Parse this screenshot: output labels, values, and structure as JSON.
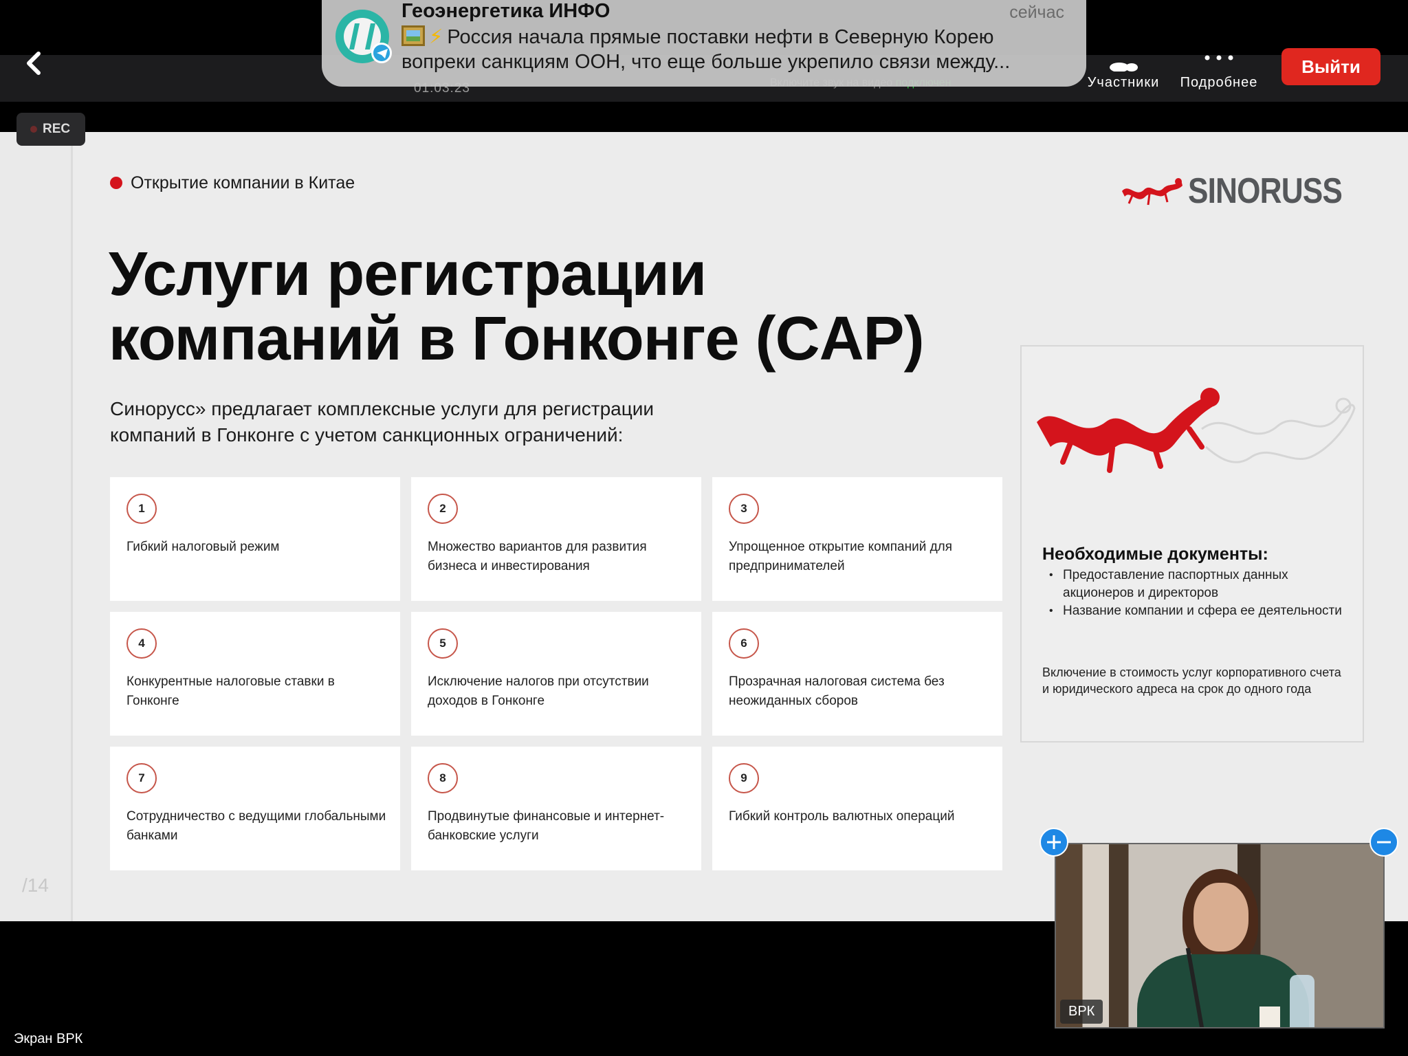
{
  "toolbar": {
    "timer": "01:03:23",
    "video_hint_prefix": "Включите звук на видео ",
    "video_hint_status": "подключен",
    "participants_label": "Участники",
    "more_label": "Подробнее",
    "leave_label": "Выйти",
    "rec_label": "REC"
  },
  "notification": {
    "title": "Геоэнергетика ИНФО",
    "time": "сейчас",
    "body": "Россия начала прямые поставки нефти в Северную Корею вопреки санкциям ООН, что еще больше укрепило связи между...",
    "emoji": "⚡"
  },
  "slide": {
    "section_tag": "Открытие компании в Китае",
    "logo_text": "SINORUSS",
    "heading_line1": "Услуги регистрации",
    "heading_line2": "компаний в Гонконге (CAP)",
    "intro": "Синорусс» предлагает комплексные услуги для регистрации компаний в Гонконге с учетом санкционных ограничений:",
    "page_number": "/14",
    "cards": [
      {
        "num": "1",
        "text": "Гибкий налоговый режим"
      },
      {
        "num": "2",
        "text": "Множество вариантов для развития бизнеса и инвестирования"
      },
      {
        "num": "3",
        "text": "Упрощенное открытие компаний для предпринимателей"
      },
      {
        "num": "4",
        "text": "Конкурентные налоговые ставки в Гонконге"
      },
      {
        "num": "5",
        "text": "Исключение налогов при отсутствии доходов в Гонконге"
      },
      {
        "num": "6",
        "text": "Прозрачная налоговая система без неожиданных сборов"
      },
      {
        "num": "7",
        "text": "Сотрудничество с ведущими глобальными банками"
      },
      {
        "num": "8",
        "text": "Продвинутые финансовые и интернет-банковские услуги"
      },
      {
        "num": "9",
        "text": "Гибкий контроль валютных операций"
      }
    ],
    "docs": {
      "title": "Необходимые документы:",
      "items": [
        "Предоставление паспортных данных акционеров и директоров",
        "Название компании и сфера ее деятельности"
      ],
      "note": "Включение в стоимость услуг корпоративного счета и юридического адреса на срок до одного года"
    }
  },
  "video": {
    "participant_label": "ВРК"
  },
  "screen_label": "Экран ВРК",
  "colors": {
    "accent_red": "#d4141c",
    "leave_red": "#e0271f",
    "tile_button_blue": "#1e88e5"
  }
}
